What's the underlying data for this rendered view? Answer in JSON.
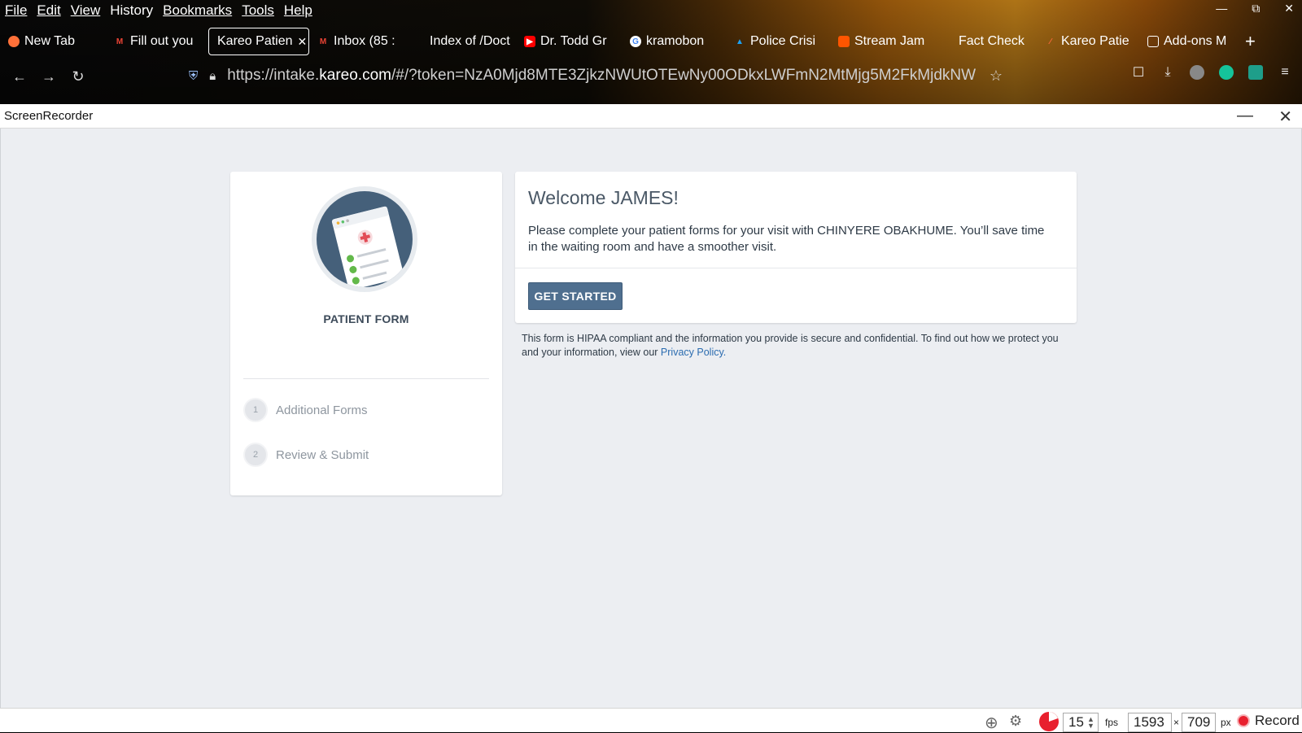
{
  "menubar": {
    "items": [
      "File",
      "Edit",
      "View",
      "History",
      "Bookmarks",
      "Tools",
      "Help"
    ]
  },
  "tabs": [
    {
      "label": "New Tab",
      "icon": "firefox-icon"
    },
    {
      "label": "Fill out you",
      "icon": "gmail-icon"
    },
    {
      "label": "Kareo Patien",
      "icon": "",
      "active": true
    },
    {
      "label": "Inbox (85 :",
      "icon": "gmail-icon"
    },
    {
      "label": "Index of /Doct",
      "icon": ""
    },
    {
      "label": "Dr. Todd Gr",
      "icon": "youtube-icon"
    },
    {
      "label": "kramobon",
      "icon": "google-icon"
    },
    {
      "label": "Police Crisi",
      "icon": "twitter-icon"
    },
    {
      "label": "Stream Jam",
      "icon": "soundcloud-icon"
    },
    {
      "label": "Fact Check",
      "icon": ""
    },
    {
      "label": "Kareo Patie",
      "icon": "kareo-icon"
    },
    {
      "label": "Add-ons M",
      "icon": "puzzle-icon"
    }
  ],
  "url": {
    "prefix": "https://intake.",
    "domain": "kareo.com",
    "rest": "/#/?token=NzA0Mjd8MTE3ZjkzNWUtOTEwNy00ODkxLWFmN2MtMjg5M2FkMjdkNW"
  },
  "recorder": {
    "title": "ScreenRecorder"
  },
  "patient_form": {
    "title": "PATIENT FORM",
    "steps": [
      {
        "num": "1",
        "label": "Additional Forms"
      },
      {
        "num": "2",
        "label": "Review & Submit"
      }
    ]
  },
  "welcome": {
    "heading": "Welcome JAMES!",
    "message": "Please complete your patient forms for your visit with CHINYERE OBAKHUME. You’ll save time in the waiting room and have a smoother visit.",
    "button": "GET STARTED"
  },
  "hipaa": {
    "text": "This form is HIPAA compliant and the information you provide is secure and confidential. To find out how we protect you and your information, view our ",
    "link": "Privacy Policy."
  },
  "statusbar": {
    "fps": "15",
    "fps_unit": "fps",
    "width": "1593",
    "times": "×",
    "height": "709",
    "px_unit": "px",
    "record_label": "Record"
  },
  "colors": {
    "primary_button": "#4f6f8f",
    "page_bg": "#eceef2",
    "link": "#2b6cb0"
  }
}
